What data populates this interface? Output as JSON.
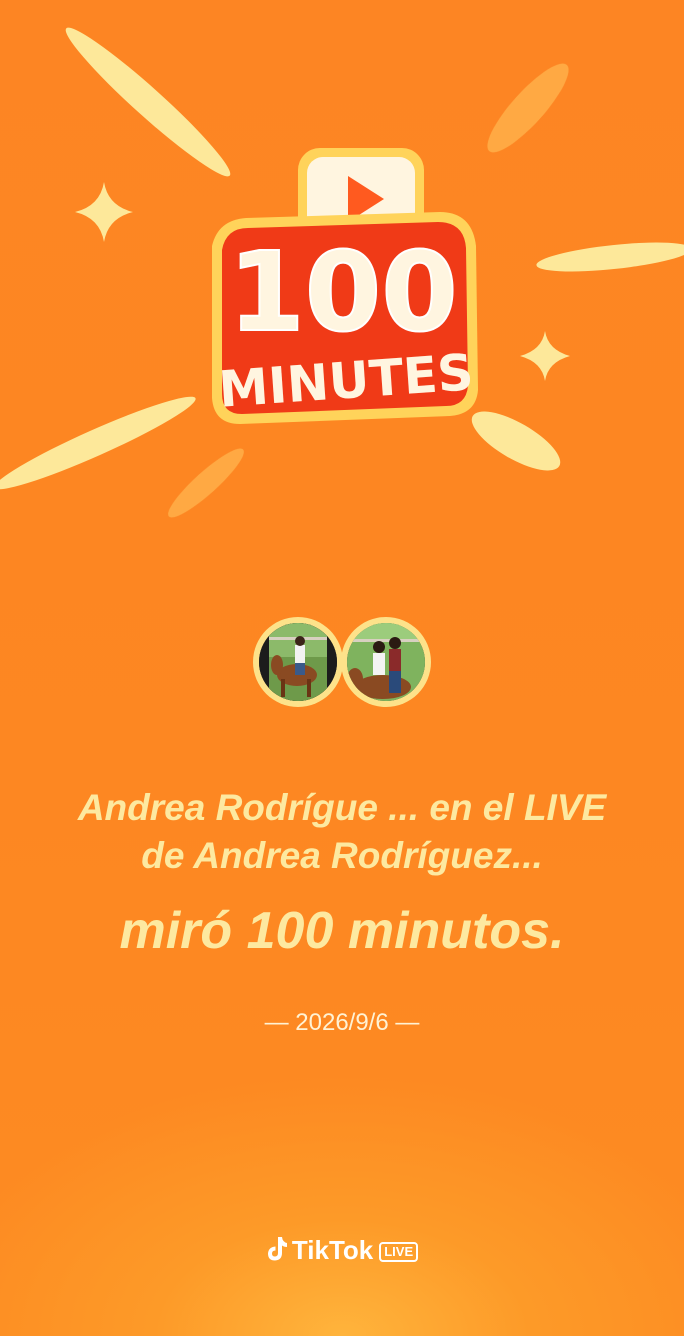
{
  "badge": {
    "number": "100",
    "word": "MINUTES"
  },
  "avatars": {
    "first_name": "avatar-andrea-1",
    "second_name": "avatar-andrea-2"
  },
  "message": {
    "line1": "Andrea Rodrígue ... en el LIVE",
    "line2": "de Andrea Rodríguez...",
    "line3": "miró 100 minutos."
  },
  "date": "— 2026/9/6 —",
  "brand": {
    "name": "TikTok",
    "tag": "LIVE"
  },
  "colors": {
    "background": "#fd8523",
    "text": "#fde9a0",
    "badge_red": "#f03a17"
  }
}
